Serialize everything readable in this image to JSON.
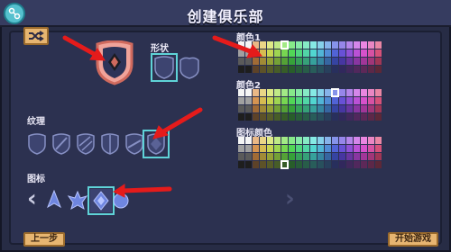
{
  "header": {
    "title": "创建俱乐部"
  },
  "sections": {
    "shape_label": "形状",
    "texture_label": "纹理",
    "icon_label": "图标",
    "color1_label": "颜色1",
    "color2_label": "颜色2",
    "icon_color_label": "图标颜色"
  },
  "footer": {
    "back_label": "上一步",
    "start_label": "开始游戏"
  },
  "colors": {
    "accent": "#5fd3d8",
    "button": "#e7b571",
    "badge_fill": "#f0a39a",
    "badge_stroke": "#d06a5e",
    "arrow": "#e51b1b"
  },
  "icons": [
    "settings-icon",
    "shuffle-icon",
    "chevron-left-icon",
    "chevron-right-icon"
  ]
}
